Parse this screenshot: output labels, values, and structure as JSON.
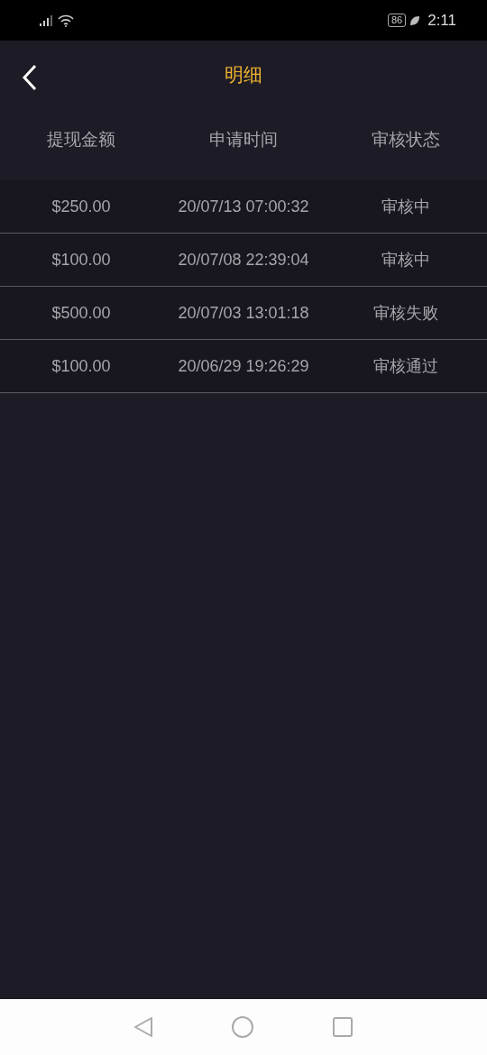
{
  "status_bar": {
    "battery": "86",
    "time": "2:11"
  },
  "header": {
    "title": "明细"
  },
  "table": {
    "columns": [
      "提现金额",
      "申请时间",
      "审核状态"
    ],
    "rows": [
      {
        "amount": "$250.00",
        "time": "20/07/13 07:00:32",
        "status": "审核中"
      },
      {
        "amount": "$100.00",
        "time": "20/07/08 22:39:04",
        "status": "审核中"
      },
      {
        "amount": "$500.00",
        "time": "20/07/03 13:01:18",
        "status": "审核失败"
      },
      {
        "amount": "$100.00",
        "time": "20/06/29 19:26:29",
        "status": "审核通过"
      }
    ]
  }
}
